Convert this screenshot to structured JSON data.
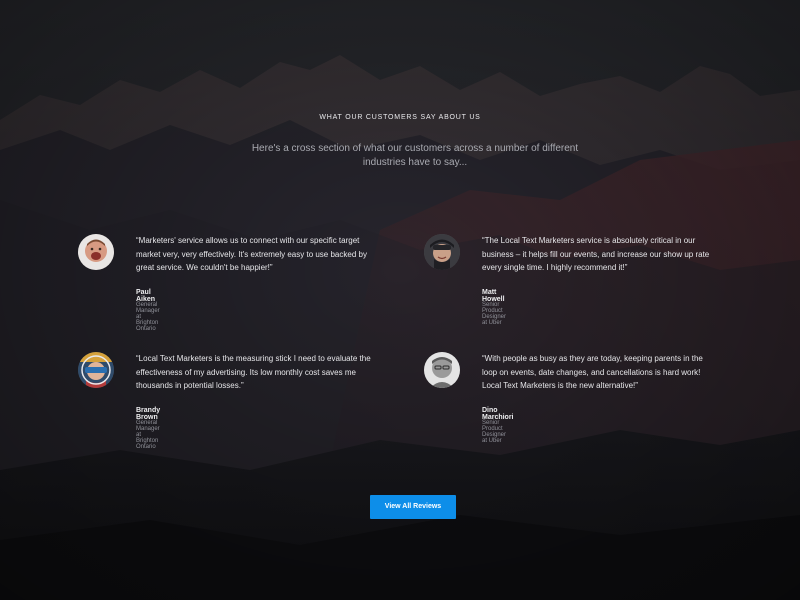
{
  "section": {
    "eyebrow": "WHAT OUR CUSTOMERS SAY ABOUT US",
    "subtitle": "Here's a cross section of what our customers across a number of different industries have to say..."
  },
  "testimonials": [
    {
      "quote": "“Marketers' service allows us to connect with our specific target market very, very effectively. It's extremely easy to use backed by great service. We couldn't be happier!”",
      "name": "Paul Aiken",
      "role": "General Manager at Brighton Ontario"
    },
    {
      "quote": "“The Local Text Marketers service is absolutely critical in our business – it helps fill our events, and increase our show up rate every single time. I highly recommend it!”",
      "name": "Matt Howell",
      "role": "Senior Product Designer at Uber"
    },
    {
      "quote": "“Local Text Marketers is the measuring stick I need to evaluate the effectiveness of my advertising. Its low monthly cost saves me thousands in potential losses.”",
      "name": "Brandy Brown",
      "role": "General Manager at Brighton Ontario"
    },
    {
      "quote": "“With people as busy as they are today, keeping parents in the loop on events, date changes, and cancellations is hard work! Local Text Marketers is the new alternative!”",
      "name": "Dino Marchiori",
      "role": "Senior Product Designer at Uber"
    }
  ],
  "cta": {
    "label": "View All Reviews"
  },
  "colors": {
    "accent": "#0d8ee9",
    "background": "#1b1c20"
  }
}
